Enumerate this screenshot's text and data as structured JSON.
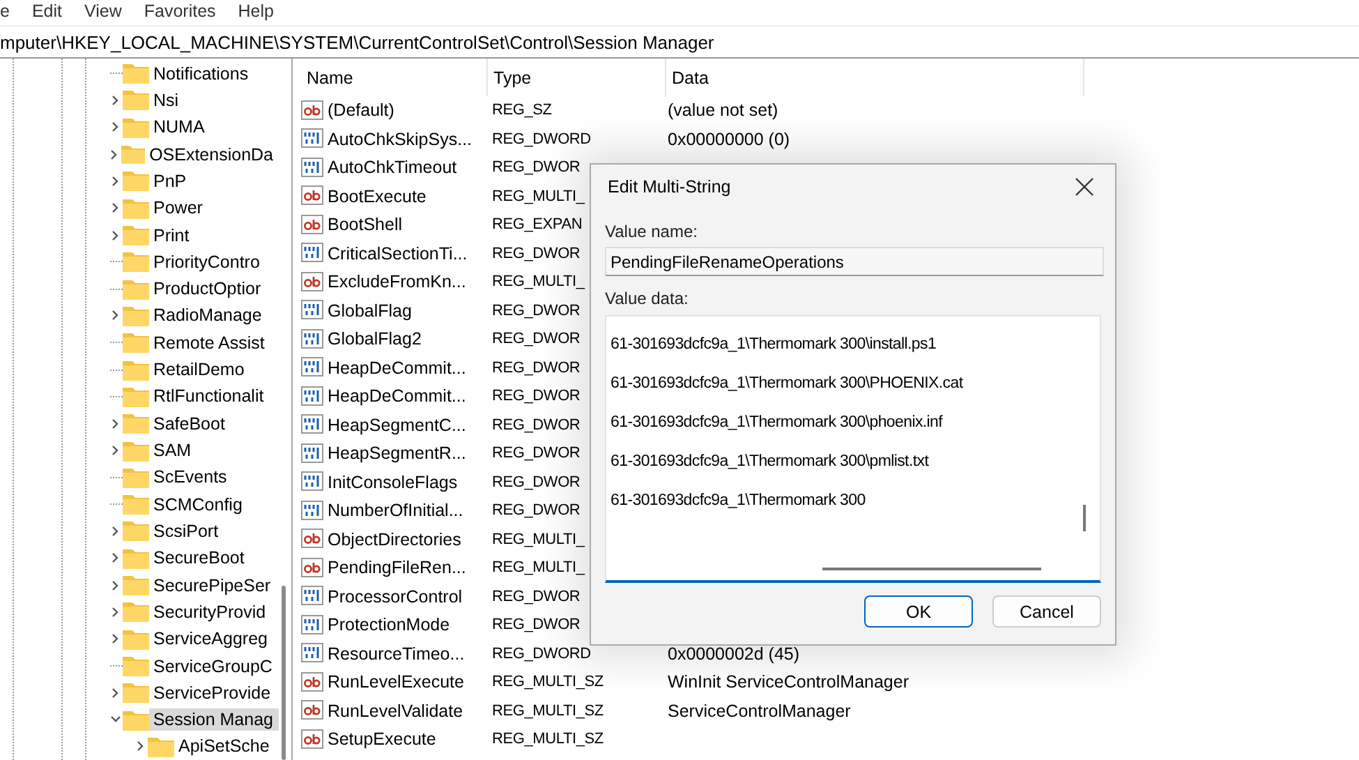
{
  "menu": [
    "e",
    "Edit",
    "View",
    "Favorites",
    "Help"
  ],
  "address": "mputer\\HKEY_LOCAL_MACHINE\\SYSTEM\\CurrentControlSet\\Control\\Session Manager",
  "tree": [
    {
      "label": "Notifications",
      "expandable": false,
      "selected": false
    },
    {
      "label": "Nsi",
      "expandable": true,
      "expanded": false,
      "selected": false
    },
    {
      "label": "NUMA",
      "expandable": true,
      "expanded": false,
      "selected": false
    },
    {
      "label": "OSExtensionDa",
      "expandable": true,
      "expanded": false,
      "selected": false
    },
    {
      "label": "PnP",
      "expandable": true,
      "expanded": false,
      "selected": false
    },
    {
      "label": "Power",
      "expandable": true,
      "expanded": false,
      "selected": false
    },
    {
      "label": "Print",
      "expandable": true,
      "expanded": false,
      "selected": false
    },
    {
      "label": "PriorityContro",
      "expandable": false,
      "selected": false
    },
    {
      "label": "ProductOptior",
      "expandable": false,
      "selected": false
    },
    {
      "label": "RadioManage",
      "expandable": true,
      "expanded": false,
      "selected": false
    },
    {
      "label": "Remote Assist",
      "expandable": false,
      "selected": false
    },
    {
      "label": "RetailDemo",
      "expandable": false,
      "selected": false
    },
    {
      "label": "RtlFunctionalit",
      "expandable": false,
      "selected": false
    },
    {
      "label": "SafeBoot",
      "expandable": true,
      "expanded": false,
      "selected": false
    },
    {
      "label": "SAM",
      "expandable": true,
      "expanded": false,
      "selected": false
    },
    {
      "label": "ScEvents",
      "expandable": false,
      "selected": false
    },
    {
      "label": "SCMConfig",
      "expandable": false,
      "selected": false
    },
    {
      "label": "ScsiPort",
      "expandable": true,
      "expanded": false,
      "selected": false
    },
    {
      "label": "SecureBoot",
      "expandable": true,
      "expanded": false,
      "selected": false
    },
    {
      "label": "SecurePipeSer",
      "expandable": true,
      "expanded": false,
      "selected": false
    },
    {
      "label": "SecurityProvid",
      "expandable": true,
      "expanded": false,
      "selected": false
    },
    {
      "label": "ServiceAggreg",
      "expandable": true,
      "expanded": false,
      "selected": false
    },
    {
      "label": "ServiceGroupC",
      "expandable": false,
      "selected": false
    },
    {
      "label": "ServiceProvide",
      "expandable": true,
      "expanded": false,
      "selected": false
    },
    {
      "label": "Session Manag",
      "expandable": true,
      "expanded": true,
      "selected": true,
      "children": [
        {
          "label": "ApiSetSche",
          "expandable": true,
          "expanded": false,
          "selected": false
        }
      ]
    }
  ],
  "columns": [
    "Name",
    "Type",
    "Data"
  ],
  "values": [
    {
      "kind": "string",
      "name": "(Default)",
      "type": "REG_SZ",
      "data": "(value not set)"
    },
    {
      "kind": "binary",
      "name": "AutoChkSkipSys...",
      "type": "REG_DWORD",
      "data": "0x00000000 (0)"
    },
    {
      "kind": "binary",
      "name": "AutoChkTimeout",
      "type": "REG_DWOR"
    },
    {
      "kind": "string",
      "name": "BootExecute",
      "type": "REG_MULTI_"
    },
    {
      "kind": "string",
      "name": "BootShell",
      "type": "REG_EXPAN"
    },
    {
      "kind": "binary",
      "name": "CriticalSectionTi...",
      "type": "REG_DWOR"
    },
    {
      "kind": "string",
      "name": "ExcludeFromKn...",
      "type": "REG_MULTI_"
    },
    {
      "kind": "binary",
      "name": "GlobalFlag",
      "type": "REG_DWOR"
    },
    {
      "kind": "binary",
      "name": "GlobalFlag2",
      "type": "REG_DWOR"
    },
    {
      "kind": "binary",
      "name": "HeapDeCommit...",
      "type": "REG_DWOR"
    },
    {
      "kind": "binary",
      "name": "HeapDeCommit...",
      "type": "REG_DWOR"
    },
    {
      "kind": "binary",
      "name": "HeapSegmentC...",
      "type": "REG_DWOR"
    },
    {
      "kind": "binary",
      "name": "HeapSegmentR...",
      "type": "REG_DWOR"
    },
    {
      "kind": "binary",
      "name": "InitConsoleFlags",
      "type": "REG_DWOR"
    },
    {
      "kind": "binary",
      "name": "NumberOfInitial...",
      "type": "REG_DWOR"
    },
    {
      "kind": "string",
      "name": "ObjectDirectories",
      "type": "REG_MULTI_"
    },
    {
      "kind": "string",
      "name": "PendingFileRen...",
      "type": "REG_MULTI_"
    },
    {
      "kind": "binary",
      "name": "ProcessorControl",
      "type": "REG_DWOR"
    },
    {
      "kind": "binary",
      "name": "ProtectionMode",
      "type": "REG_DWOR"
    },
    {
      "kind": "binary",
      "name": "ResourceTimeo...",
      "type": "REG_DWORD",
      "data": "0x0000002d (45)"
    },
    {
      "kind": "string",
      "name": "RunLevelExecute",
      "type": "REG_MULTI_SZ",
      "data": "WinInit ServiceControlManager"
    },
    {
      "kind": "string",
      "name": "RunLevelValidate",
      "type": "REG_MULTI_SZ",
      "data": "ServiceControlManager"
    },
    {
      "kind": "string",
      "name": "SetupExecute",
      "type": "REG_MULTI_SZ"
    }
  ],
  "dialog": {
    "title": "Edit Multi-String",
    "value_name_label": "Value name:",
    "value_name": "PendingFileRenameOperations",
    "value_data_label": "Value data:",
    "value_data": [
      "61-301693dcfc9a_1\\Thermomark 300\\install.ps1",
      "61-301693dcfc9a_1\\Thermomark 300\\PHOENIX.cat",
      "61-301693dcfc9a_1\\Thermomark 300\\phoenix.inf",
      "61-301693dcfc9a_1\\Thermomark 300\\pmlist.txt",
      "61-301693dcfc9a_1\\Thermomark 300"
    ],
    "buttons": [
      {
        "label": "OK",
        "default": true
      },
      {
        "label": "Cancel",
        "default": false
      }
    ]
  }
}
